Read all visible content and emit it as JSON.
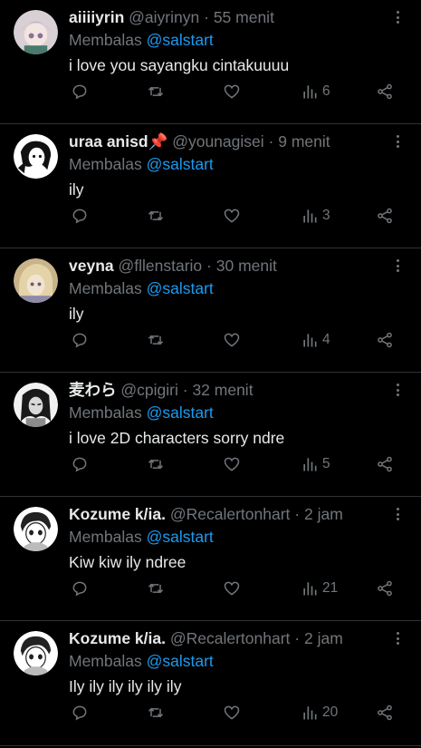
{
  "replying_prefix": "Membalas",
  "replies": [
    {
      "name": "aiiiiyrin",
      "handle": "@aiyrinyn",
      "separator": "·",
      "time": "55 menit",
      "mention": "@salstart",
      "text": "i love you sayangku cintakuuuu",
      "views": "6",
      "avatar_colors": [
        "#d9d0d6",
        "#8a6f9e",
        "#f3e6e0"
      ]
    },
    {
      "name": "uraa anisd📌",
      "handle": "@younagisei",
      "separator": "·",
      "time": "9 menit",
      "mention": "@salstart",
      "text": "ily",
      "views": "3",
      "avatar_colors": [
        "#ffffff",
        "#111111",
        "#d8d8d8"
      ]
    },
    {
      "name": "veyna",
      "handle": "@fllenstario",
      "separator": "·",
      "time": "30 menit",
      "mention": "@salstart",
      "text": "ily",
      "views": "4",
      "avatar_colors": [
        "#e4d3a8",
        "#6b5a7a",
        "#c9b48a"
      ]
    },
    {
      "name": "麦わら",
      "handle": "@cpigiri",
      "separator": "·",
      "time": "32 menit",
      "mention": "@salstart",
      "text": "i love 2D characters sorry ndre",
      "views": "5",
      "avatar_colors": [
        "#f2f2f2",
        "#1a1a1a",
        "#8c8c8c"
      ]
    },
    {
      "name": "Kozume k/ia.",
      "handle": "@Recalertonhart",
      "separator": "·",
      "time": "2 jam",
      "mention": "@salstart",
      "text": "Kiw kiw ily ndree",
      "views": "21",
      "avatar_colors": [
        "#ffffff",
        "#222222",
        "#bbbbbb"
      ]
    },
    {
      "name": "Kozume k/ia.",
      "handle": "@Recalertonhart",
      "separator": "·",
      "time": "2 jam",
      "mention": "@salstart",
      "text": "Ily ily ily ily ily ily",
      "views": "20",
      "avatar_colors": [
        "#ffffff",
        "#222222",
        "#bbbbbb"
      ]
    }
  ],
  "icons": {
    "reply": "comment-bubble-icon",
    "retweet": "retweet-icon",
    "like": "heart-icon",
    "views": "views-bar-chart-icon",
    "share": "share-icon",
    "more": "more-vertical-icon"
  },
  "colors": {
    "background": "#000000",
    "text": "#e7e9ea",
    "muted": "#71767b",
    "mention": "#1d9bf0",
    "divider": "#2f3336"
  }
}
